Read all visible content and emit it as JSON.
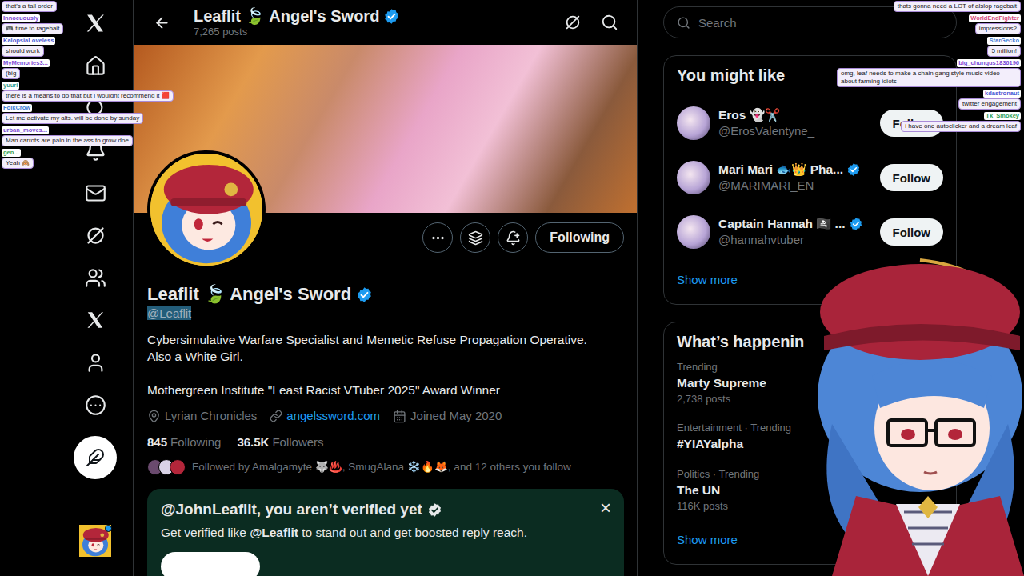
{
  "header": {
    "title": "Leaflit 🍃 Angel's Sword",
    "verified": true,
    "posts": "7,265 posts"
  },
  "nav": {
    "account_badge": true
  },
  "profile": {
    "name": "Leaflit 🍃 Angel's Sword",
    "verified": true,
    "handle": "@Leaflit",
    "handle_selected": true,
    "bio_lines": [
      "Cybersimulative Warfare Specialist and Memetic Refuse Propagation Operative.",
      "Also a White Girl."
    ],
    "award": "Mothergreen Institute \"Least Racist VTuber 2025\" Award Winner",
    "location": "Lyrian Chronicles",
    "website": "angelssword.com",
    "joined": "Joined May 2020",
    "following_count": "845",
    "following_label": "Following",
    "followers_count": "36.5K",
    "followers_label": "Followers",
    "followed_by": "Followed by Amalgamyte 🐺♨️, SmugAlana ❄️🔥🦊, and 12 others you follow",
    "follow_button": "Following"
  },
  "verify_card": {
    "title": "@JohnLeaflit, you aren’t verified yet",
    "badge": true,
    "body_before": "Get verified like ",
    "mention": "@Leaflit",
    "body_after": " to stand out and get boosted reply reach.",
    "close": "×"
  },
  "search": {
    "placeholder": "Search"
  },
  "you_might_like": {
    "title": "You might like",
    "users": [
      {
        "name": "Eros 👻✂️",
        "handle": "@ErosValentyne_",
        "verified": false,
        "button": "Follow"
      },
      {
        "name": "Mari Mari 🐟👑 Pha...",
        "handle": "@MARIMARI_EN",
        "verified": true,
        "button": "Follow"
      },
      {
        "name": "Captain Hannah 🏴‍☠️ ...",
        "handle": "@hannahvtuber",
        "verified": true,
        "button": "Follow"
      }
    ],
    "more": "Show more"
  },
  "whats_happening": {
    "title": "What’s happenin",
    "trends": [
      {
        "context": "Trending",
        "topic": "Marty Supreme",
        "count": "2,738 posts"
      },
      {
        "context": "Entertainment · Trending",
        "topic": "#YIAYalpha",
        "count": ""
      },
      {
        "context": "Politics · Trending",
        "topic": "The UN",
        "count": "116K posts"
      }
    ],
    "more": "Show more"
  },
  "chat_left": [
    {
      "user": "",
      "color": "#7b4bd6",
      "message": "that's a tall order"
    },
    {
      "user": "Innocuously",
      "color": "#7b4bd6",
      "message": "🎮 time to ragebait"
    },
    {
      "user": "KalopsiaLoveless",
      "color": "#4b5bd6",
      "message": "should work"
    },
    {
      "user": "MyMemories3...",
      "color": "#7b4bd6",
      "message": "(big"
    },
    {
      "user": "yuuri",
      "color": "#2f9e8f",
      "message": "there is a means to do that but i wouldnt recommend it 🟥"
    },
    {
      "user": "FolkCrow",
      "color": "#3b7bd6",
      "message": "Let me activate my alts. will be done by sunday"
    },
    {
      "user": "urban_moves...",
      "color": "#7b4bd6",
      "message": "Man carrots are pain in the ass to grow doe"
    },
    {
      "user": "gen...",
      "color": "#2f9e4f",
      "message": "Yeah 🙈"
    }
  ],
  "chat_right": [
    {
      "user": "",
      "color": "#d64b7b",
      "message": "thats gonna need a LOT of alslop ragebait"
    },
    {
      "user": "WorldEndFighter",
      "color": "#d64b7b",
      "message": "impressions?"
    },
    {
      "user": "StarGecko",
      "color": "#4b7bd6",
      "message": "5 million!"
    },
    {
      "user": "big_chungus1836196",
      "color": "#7b4bd6",
      "message": "omg, leaf needs to make a chain gang style music video about farming idiots"
    },
    {
      "user": "kdastronaut",
      "color": "#4b5bd6",
      "message": "twitter engagement"
    },
    {
      "user": "Tk_Smokey",
      "color": "#2f9e4f",
      "message": "i have one autoclicker and a dream leaf"
    }
  ]
}
